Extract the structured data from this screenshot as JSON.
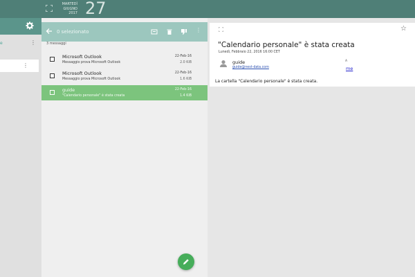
{
  "topbar": {
    "weekday": "MARTEDÌ",
    "month": "GIUGNO",
    "year": "2017",
    "day": "27"
  },
  "sidebar": {
    "item1_label": "e"
  },
  "toolbar": {
    "selection_text": "0 selezionato"
  },
  "list": {
    "count_text": "3 messaggi",
    "messages": [
      {
        "from": "Microsoft Outlook",
        "subject": "Messaggio prova Microsoft Outlook",
        "date": "22-Feb-16",
        "size": "2.0 KiB"
      },
      {
        "from": "Microsoft Outlook",
        "subject": "Messaggio prova Microsoft Outlook",
        "date": "22-Feb-16",
        "size": "1.6 KiB"
      },
      {
        "from": "guide",
        "subject": "\"Calendario personale\" è stata creata",
        "date": "22-Feb-16",
        "size": "1.4 KiB"
      }
    ]
  },
  "reader": {
    "title": "\"Calendario personale\" è stata creata",
    "sent": "Lunedì, Febbraio 22, 2016 16:00 CET",
    "sender_name": "guide",
    "sender_email": "guide@nest-data.com",
    "to_label": "A",
    "to_value": "me",
    "body": "La cartella \"Calendario personale\" è stata creata."
  },
  "colors": {
    "topbar": "#4f7f77",
    "list_header": "#9cc7be",
    "selected_row": "#7cc47d",
    "fab": "#46ad5a"
  }
}
